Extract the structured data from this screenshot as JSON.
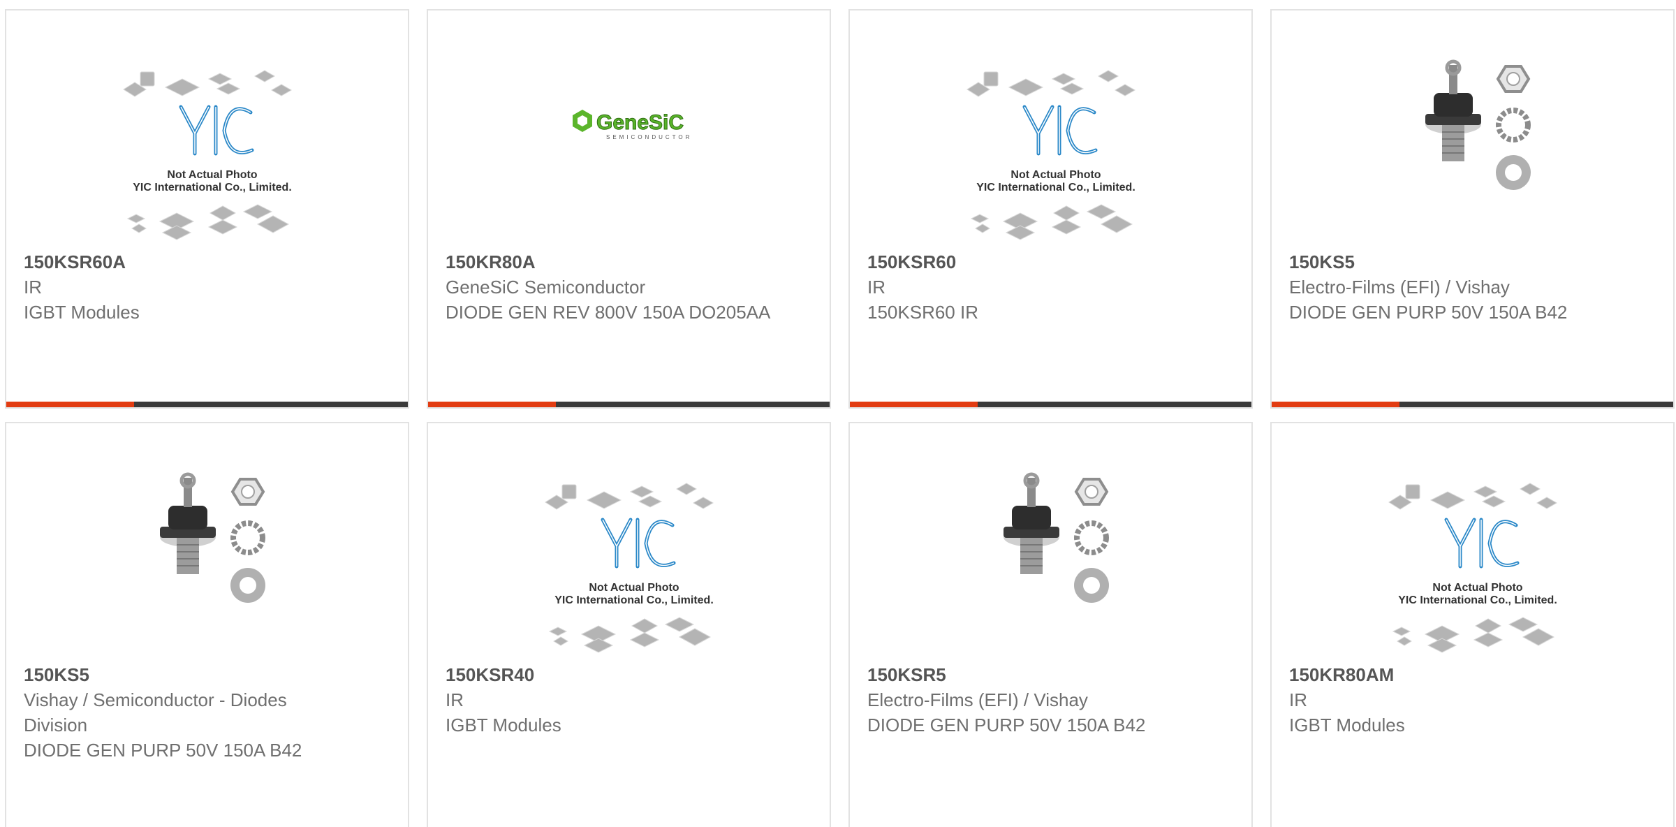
{
  "accent_color": "#e23c12",
  "bar_color": "#3a3a3a",
  "placeholder_text": {
    "line1": "Not Actual Photo",
    "line2": "YIC International Co., Limited."
  },
  "logos": {
    "genesic": {
      "name": "GeneSiC",
      "sub": "SEMICONDUCTOR"
    },
    "yic": "YIC"
  },
  "products": [
    {
      "part": "150KSR60A",
      "manufacturer": "IR",
      "desc": "IGBT Modules",
      "image": "yic-placeholder"
    },
    {
      "part": "150KR80A",
      "manufacturer": "GeneSiC Semiconductor",
      "desc": "DIODE GEN REV 800V 150A DO205AA",
      "image": "genesic-logo"
    },
    {
      "part": "150KSR60",
      "manufacturer": "IR",
      "desc": "150KSR60 IR",
      "image": "yic-placeholder"
    },
    {
      "part": "150KS5",
      "manufacturer": "Electro-Films (EFI) / Vishay",
      "desc": "DIODE GEN PURP 50V 150A B42",
      "image": "stud-diode"
    },
    {
      "part": "150KS5",
      "manufacturer": "Vishay / Semiconductor - Diodes Division",
      "desc": "DIODE GEN PURP 50V 150A B42",
      "image": "stud-diode"
    },
    {
      "part": "150KSR40",
      "manufacturer": "IR",
      "desc": "IGBT Modules",
      "image": "yic-placeholder"
    },
    {
      "part": "150KSR5",
      "manufacturer": "Electro-Films (EFI) / Vishay",
      "desc": "DIODE GEN PURP 50V 150A B42",
      "image": "stud-diode"
    },
    {
      "part": "150KR80AM",
      "manufacturer": "IR",
      "desc": "IGBT Modules",
      "image": "yic-placeholder"
    }
  ]
}
